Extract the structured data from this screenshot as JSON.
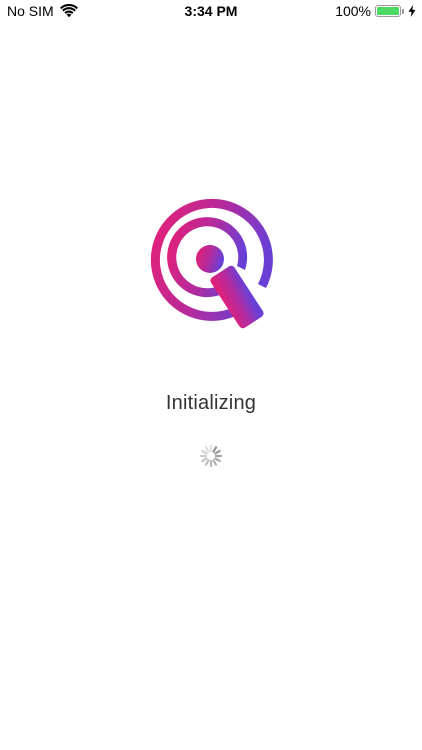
{
  "status_bar": {
    "carrier": "No SIM",
    "time": "3:34 PM",
    "battery_percent": "100%",
    "battery_level": 1.0,
    "wifi_icon": "wifi-icon",
    "charging_icon": "bolt-icon"
  },
  "splash": {
    "logo_icon": "podcast-app-logo",
    "status_text": "Initializing",
    "spinner_icon": "activity-spinner"
  },
  "colors": {
    "gradient_start": "#e8207a",
    "gradient_end": "#6a3fd6",
    "battery_fill": "#4cd964"
  }
}
